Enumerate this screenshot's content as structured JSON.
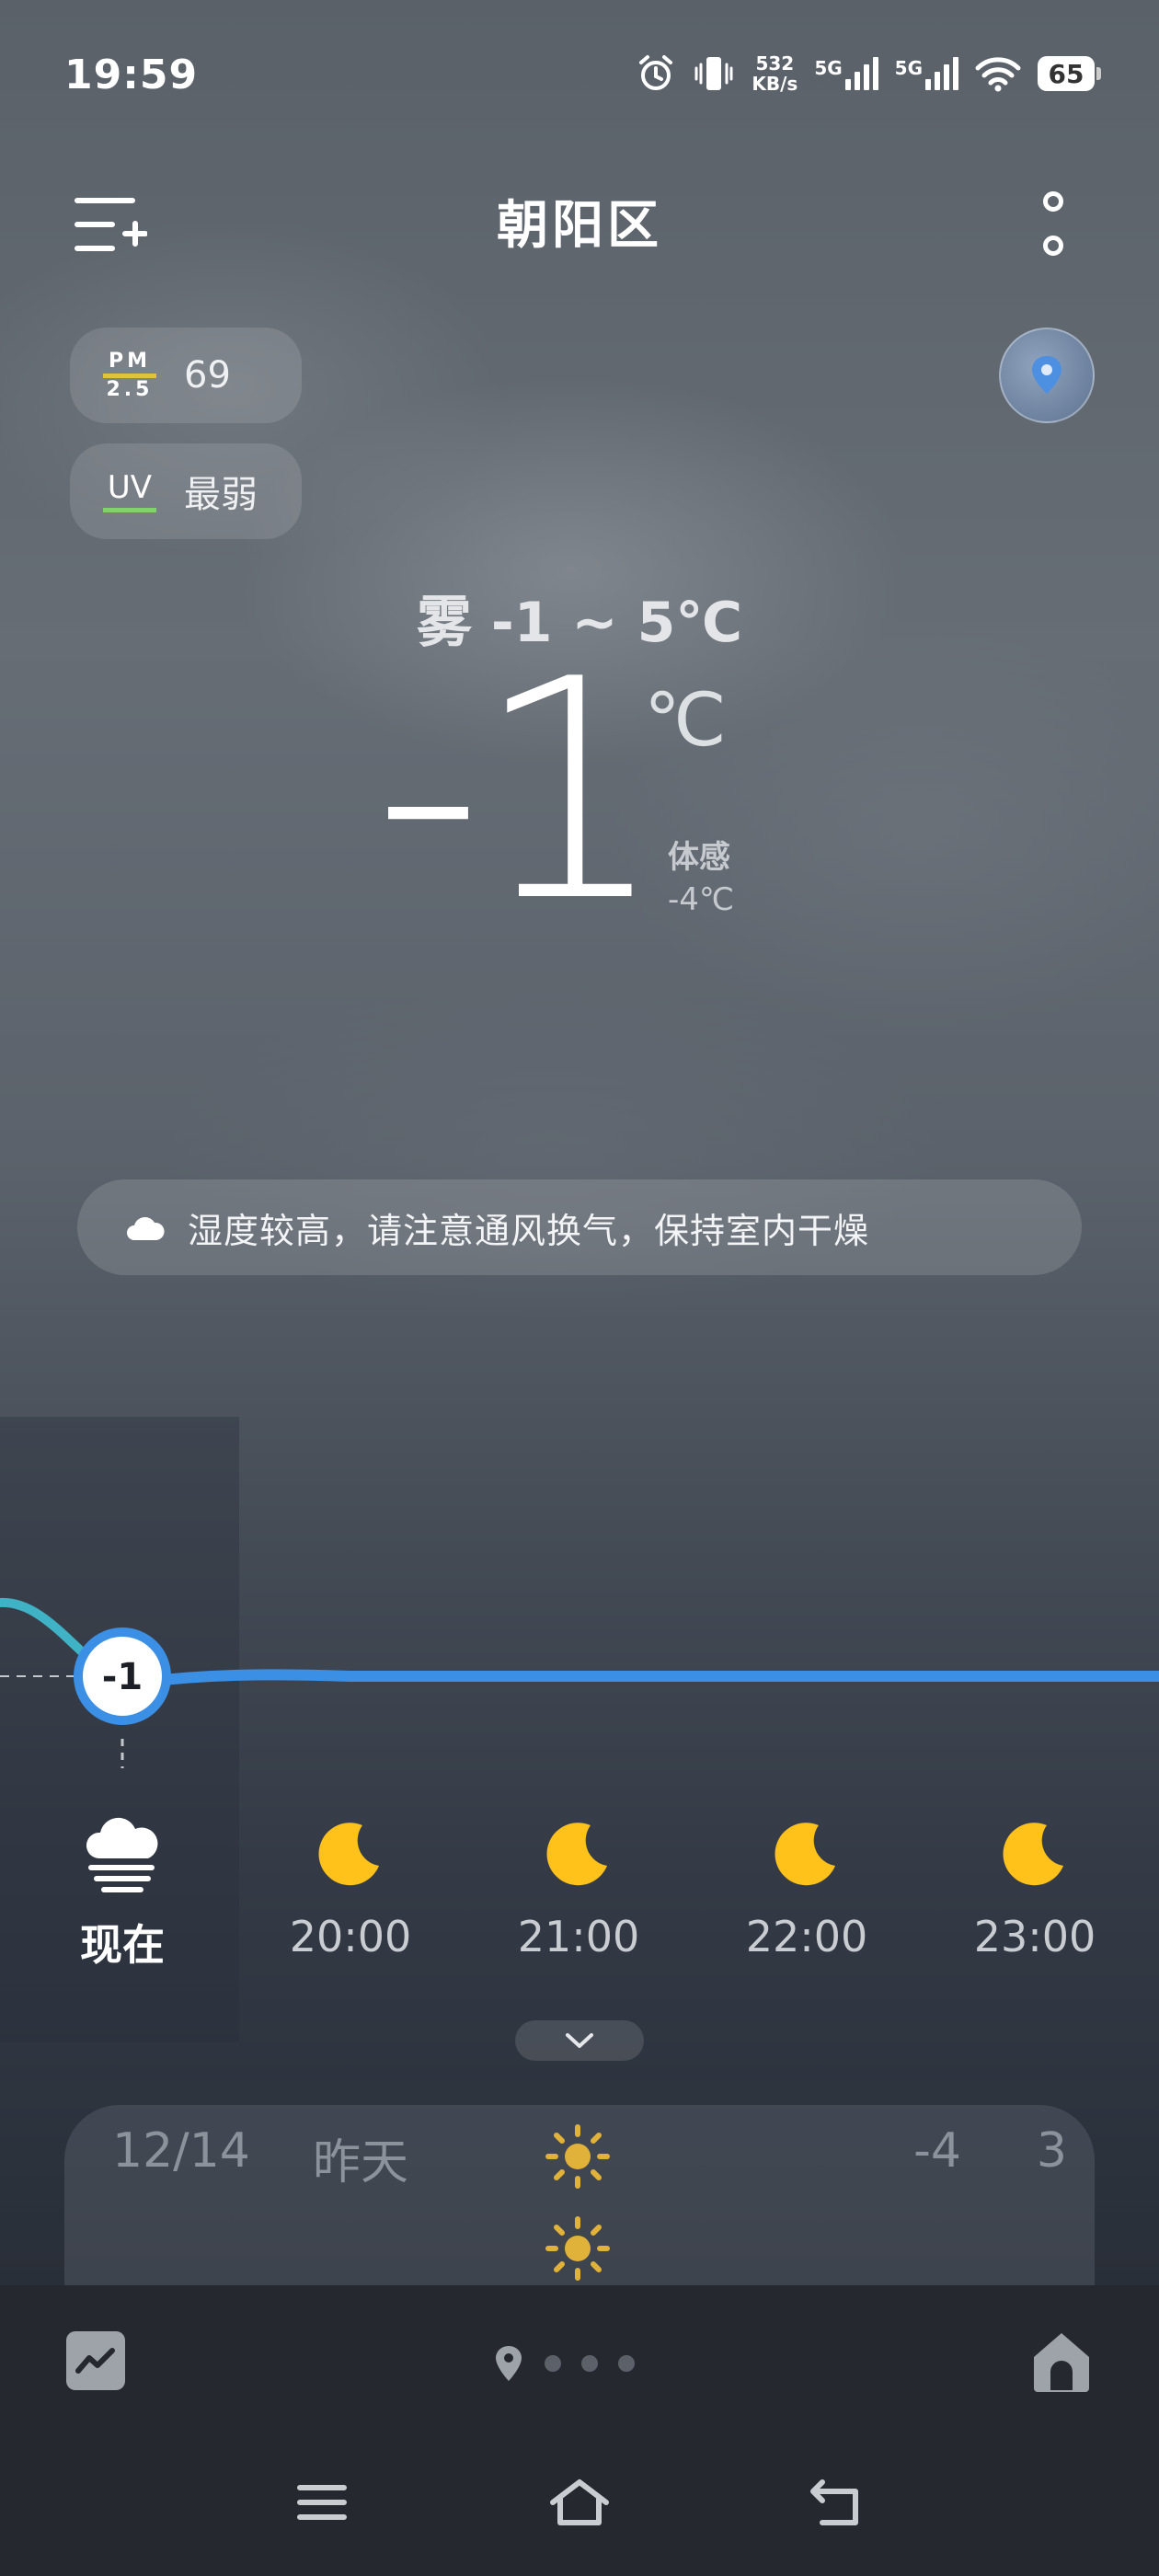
{
  "status_bar": {
    "time": "19:59",
    "net_speed_value": "532",
    "net_speed_unit": "KB/s",
    "sim1": "5G",
    "sim2": "5G",
    "battery": "65"
  },
  "header": {
    "city": "朝阳区"
  },
  "air": {
    "pm_label_top": "PM",
    "pm_label_bottom": "2.5",
    "pm_value": "69",
    "uv_label": "UV",
    "uv_value": "最弱"
  },
  "current": {
    "condition_range": "雾  -1 ~ 5℃",
    "temperature": "-1",
    "unit": "℃",
    "feels_label": "体感",
    "feels_value": "-4℃"
  },
  "tip": {
    "text": "湿度较高，请注意通风换气，保持室内干燥"
  },
  "hourly": {
    "current_temp_label": "-1",
    "items": [
      {
        "time": "现在",
        "icon": "fog-icon"
      },
      {
        "time": "20:00",
        "icon": "moon-icon"
      },
      {
        "time": "21:00",
        "icon": "moon-icon"
      },
      {
        "time": "22:00",
        "icon": "moon-icon"
      },
      {
        "time": "23:00",
        "icon": "moon-icon"
      }
    ]
  },
  "daily": [
    {
      "date": "12/14",
      "weekday": "昨天",
      "icon": "sun-icon",
      "low": "-4",
      "high": "3"
    }
  ],
  "colors": {
    "accent_line": "#3b8fe5",
    "sun": "#e0b23a",
    "moon": "#ffc21a"
  }
}
